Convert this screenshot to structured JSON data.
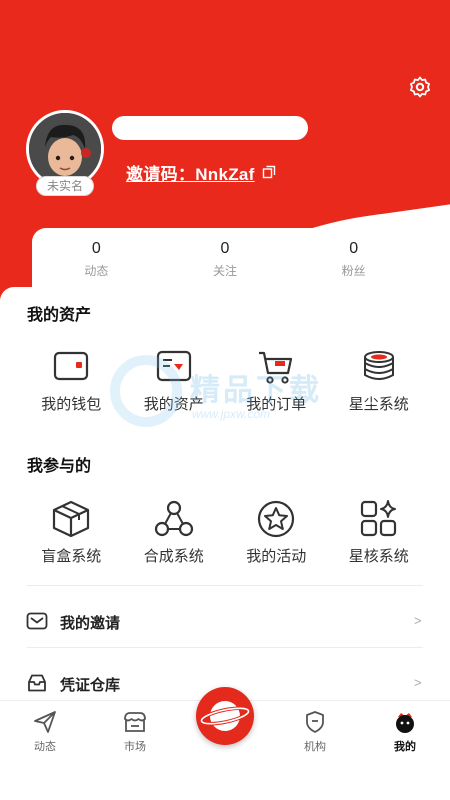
{
  "colors": {
    "brand_red": "#e8291c",
    "background": "#ffffff"
  },
  "header": {
    "settings_icon": "gear-icon",
    "verify_badge": "未实名",
    "invite_code_text": "邀请码：NnkZaf",
    "copy_icon": "copy-icon"
  },
  "stats": [
    {
      "value": "0",
      "label": "动态"
    },
    {
      "value": "0",
      "label": "关注"
    },
    {
      "value": "0",
      "label": "粉丝"
    }
  ],
  "assets": {
    "title": "我的资产",
    "items": [
      {
        "label": "我的钱包",
        "icon": "wallet-icon"
      },
      {
        "label": "我的资产",
        "icon": "asset-card-icon"
      },
      {
        "label": "我的订单",
        "icon": "cart-icon"
      },
      {
        "label": "星尘系统",
        "icon": "coin-stack-icon"
      }
    ]
  },
  "participation": {
    "title": "我参与的",
    "items": [
      {
        "label": "盲盒系统",
        "icon": "box-icon"
      },
      {
        "label": "合成系统",
        "icon": "synthesis-icon"
      },
      {
        "label": "我的活动",
        "icon": "star-icon"
      },
      {
        "label": "星核系统",
        "icon": "grid-sparkle-icon"
      }
    ]
  },
  "list": [
    {
      "label": "我的邀请",
      "icon": "envelope-icon",
      "arrow": ">"
    },
    {
      "label": "凭证仓库",
      "icon": "inbox-icon",
      "arrow": ">"
    }
  ],
  "watermark": {
    "text": "精品下载",
    "url": "www.jpxw.com"
  },
  "tabbar": {
    "items": [
      {
        "label": "动态",
        "icon": "send-icon"
      },
      {
        "label": "市场",
        "icon": "store-icon"
      },
      {
        "label": "机构",
        "icon": "shield-icon"
      },
      {
        "label": "我的",
        "icon": "profile-icon",
        "active": true
      }
    ],
    "center_icon": "planet-icon"
  }
}
